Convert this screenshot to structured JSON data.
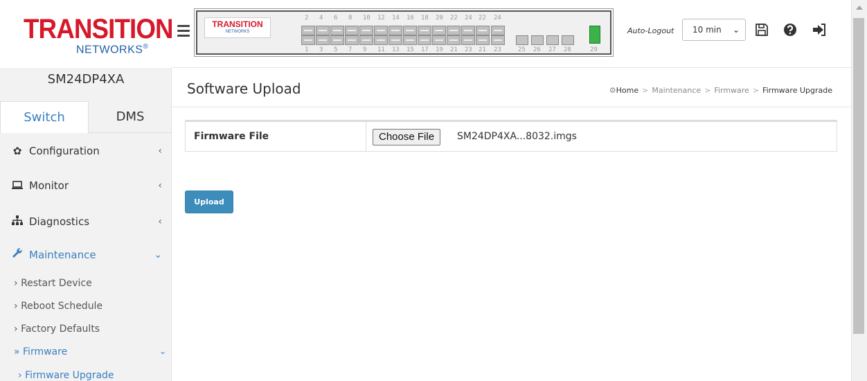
{
  "brand": {
    "logo_main": "TRANSITION",
    "logo_sub": "NETWORKS",
    "panel_logo_main": "TRANSITION",
    "panel_logo_sub": "NETWORKS",
    "accent_color": "#3a7fc1",
    "logo_red": "#d7182a"
  },
  "device": {
    "name": "SM24DP4XA"
  },
  "tabs": [
    {
      "label": "Switch",
      "active": true
    },
    {
      "label": "DMS",
      "active": false
    }
  ],
  "menu": {
    "configuration": "Configuration",
    "monitor": "Monitor",
    "diagnostics": "Diagnostics",
    "maintenance": "Maintenance",
    "maintenance_sub": {
      "restart": "Restart Device",
      "reboot": "Reboot Schedule",
      "factory": "Factory Defaults",
      "firmware": "Firmware",
      "firmware_upgrade": "Firmware Upgrade"
    }
  },
  "switch_panel": {
    "top_numbers": [
      "2",
      "4",
      "6",
      "8",
      "10",
      "12",
      "14",
      "16",
      "18",
      "20",
      "22",
      "24",
      "22",
      "24"
    ],
    "bottom_numbers": [
      "1",
      "3",
      "5",
      "7",
      "9",
      "11",
      "13",
      "15",
      "17",
      "19",
      "21",
      "23",
      "21",
      "23",
      "25",
      "26",
      "27",
      "28",
      "29"
    ]
  },
  "header": {
    "auto_logout_label": "Auto-Logout",
    "auto_logout_value": "10 min"
  },
  "page": {
    "title": "Software Upload",
    "breadcrumb": {
      "home": "Home",
      "maintenance": "Maintenance",
      "firmware": "Firmware",
      "current": "Firmware Upgrade"
    },
    "firmware_file_label": "Firmware File",
    "choose_file_label": "Choose File",
    "chosen_file": "SM24DP4XA...8032.imgs",
    "upload_label": "Upload"
  }
}
